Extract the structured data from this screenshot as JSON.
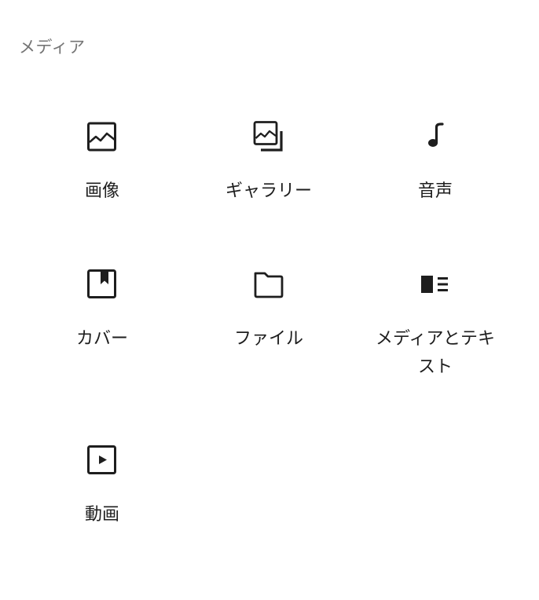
{
  "section": {
    "title": "メディア"
  },
  "blocks": [
    {
      "label": "画像",
      "icon": "image-icon"
    },
    {
      "label": "ギャラリー",
      "icon": "gallery-icon"
    },
    {
      "label": "音声",
      "icon": "audio-icon"
    },
    {
      "label": "カバー",
      "icon": "cover-icon"
    },
    {
      "label": "ファイル",
      "icon": "file-folder-icon"
    },
    {
      "label": "メディアとテキスト",
      "icon": "media-text-icon"
    },
    {
      "label": "動画",
      "icon": "video-icon"
    }
  ],
  "colors": {
    "icon": "#1e1e1e",
    "label": "#1e1e1e",
    "section_title": "#757575",
    "background": "#ffffff"
  }
}
